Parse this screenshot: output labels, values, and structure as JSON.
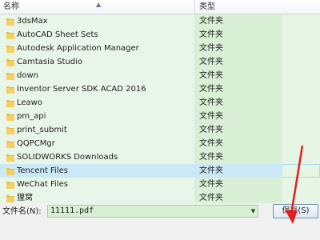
{
  "header": {
    "name_col": "名称",
    "type_col": "类型"
  },
  "files": [
    {
      "name": "3dsMax",
      "type": "文件夹"
    },
    {
      "name": "AutoCAD Sheet Sets",
      "type": "文件夹"
    },
    {
      "name": "Autodesk Application Manager",
      "type": "文件夹"
    },
    {
      "name": "Camtasia Studio",
      "type": "文件夹"
    },
    {
      "name": "down",
      "type": "文件夹"
    },
    {
      "name": "Inventor Server SDK ACAD 2016",
      "type": "文件夹"
    },
    {
      "name": "Leawo",
      "type": "文件夹"
    },
    {
      "name": "pm_api",
      "type": "文件夹"
    },
    {
      "name": "print_submit",
      "type": "文件夹"
    },
    {
      "name": "QQPCMgr",
      "type": "文件夹"
    },
    {
      "name": "SOLIDWORKS Downloads",
      "type": "文件夹"
    },
    {
      "name": "Tencent Files",
      "type": "文件夹"
    },
    {
      "name": "WeChat Files",
      "type": "文件夹"
    },
    {
      "name": "狸窝",
      "type": "文件夹"
    }
  ],
  "selected_index": 11,
  "bottom": {
    "filename_label": "文件名(N):",
    "filename_value": "11111.pdf",
    "save_label": "保存(S)"
  },
  "colors": {
    "folder": "#e8b93c",
    "annotation": "#e02020",
    "green_tint": "#d9f0d6"
  },
  "icons": {
    "folder": "folder-icon",
    "dropdown": "chevron-down-icon",
    "sort": "sort-up-icon"
  }
}
